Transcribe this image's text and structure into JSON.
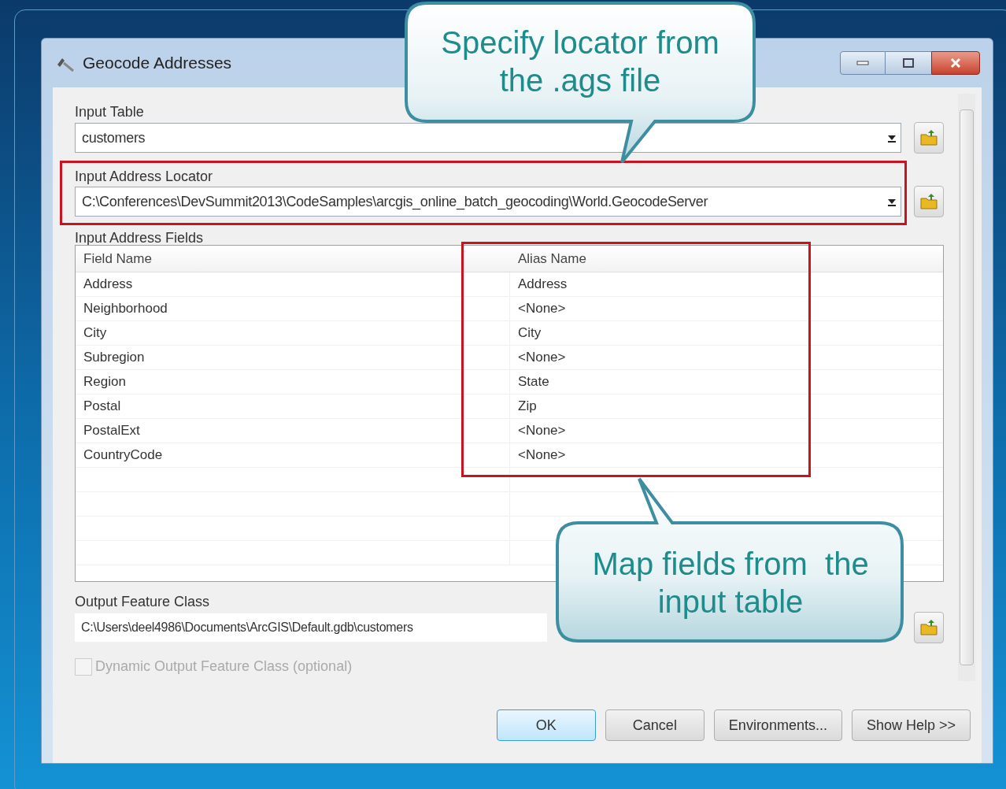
{
  "window": {
    "title": "Geocode Addresses"
  },
  "input_table": {
    "label": "Input Table",
    "value": "customers"
  },
  "address_locator": {
    "label": "Input Address Locator",
    "value": "C:\\Conferences\\DevSummit2013\\CodeSamples\\arcgis_online_batch_geocoding\\World.GeocodeServer"
  },
  "address_fields": {
    "label": "Input Address Fields",
    "columns": [
      "Field Name",
      "Alias Name"
    ],
    "rows": [
      [
        "Address",
        "Address"
      ],
      [
        "Neighborhood",
        "<None>"
      ],
      [
        "City",
        "City"
      ],
      [
        "Subregion",
        "<None>"
      ],
      [
        "Region",
        "State"
      ],
      [
        "Postal",
        "Zip"
      ],
      [
        "PostalExt",
        "<None>"
      ],
      [
        "CountryCode",
        "<None>"
      ]
    ]
  },
  "output_feature_class": {
    "label": "Output Feature Class",
    "value": "C:\\Users\\deel4986\\Documents\\ArcGIS\\Default.gdb\\customers"
  },
  "dynamic_output": {
    "label": "Dynamic Output Feature Class (optional)",
    "checked": false,
    "disabled": true
  },
  "buttons": [
    {
      "label": "OK",
      "default": true
    },
    {
      "label": "Cancel",
      "default": false
    },
    {
      "label": "Environments...",
      "default": false
    },
    {
      "label": "Show Help >>",
      "default": false
    }
  ],
  "callouts": [
    {
      "lines": [
        "Specify locator from",
        "the .ags file"
      ]
    },
    {
      "lines": [
        "Map fields from  the",
        "input table"
      ]
    }
  ]
}
